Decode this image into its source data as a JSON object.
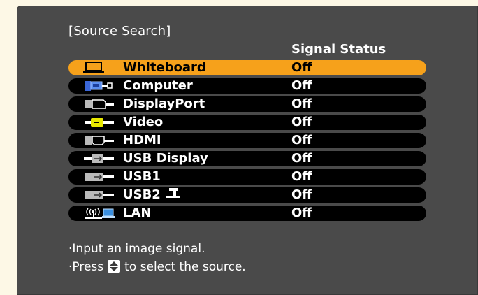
{
  "title": "[Source Search]",
  "column_header": "Signal Status",
  "sources": [
    {
      "label": "Whiteboard",
      "status": "Off",
      "icon": "whiteboard-icon",
      "selected": true
    },
    {
      "label": "Computer",
      "status": "Off",
      "icon": "computer-icon"
    },
    {
      "label": "DisplayPort",
      "status": "Off",
      "icon": "displayport-icon"
    },
    {
      "label": "Video",
      "status": "Off",
      "icon": "video-icon"
    },
    {
      "label": "HDMI",
      "status": "Off",
      "icon": "hdmi-icon"
    },
    {
      "label": "USB Display",
      "status": "Off",
      "icon": "usb-display-icon"
    },
    {
      "label": "USB1",
      "status": "Off",
      "icon": "usb1-icon"
    },
    {
      "label": "USB2",
      "status": "Off",
      "icon": "usb2-icon"
    },
    {
      "label": "LAN",
      "status": "Off",
      "icon": "lan-icon"
    }
  ],
  "hints": {
    "line1": "·Input an image signal.",
    "line2_prefix": "·Press",
    "line2_suffix": "to select the source."
  },
  "colors": {
    "background": "#4a4a4a",
    "row": "#000000",
    "selected": "#f6a11b",
    "page": "#fdf8e6"
  }
}
